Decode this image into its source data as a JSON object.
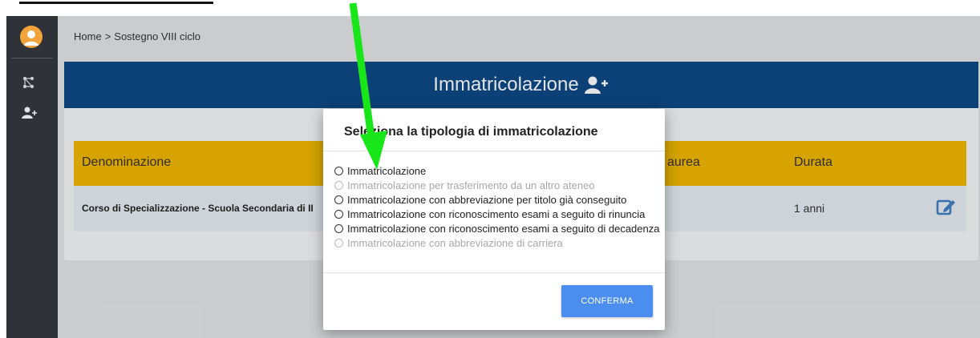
{
  "breadcrumb": {
    "home": "Home",
    "separator": ">",
    "current": "Sostegno VIII ciclo"
  },
  "banner": {
    "title": "Immatricolazione",
    "icon": "user-plus-icon"
  },
  "table": {
    "headers": [
      "Denominazione",
      "aurea",
      "Durata"
    ],
    "rows": [
      {
        "name": "Corso di Specializzazione - Scuola Secondaria di II G",
        "duration": "1 anni"
      }
    ]
  },
  "modal": {
    "title": "Seleziona la tipologia di immatricolazione",
    "options": [
      {
        "label": "Immatricolazione",
        "disabled": false
      },
      {
        "label": "Immatricolazione per trasferimento da un altro ateneo",
        "disabled": true
      },
      {
        "label": "Immatricolazione con abbreviazione per titolo già conseguito",
        "disabled": false
      },
      {
        "label": "Immatricolazione con riconoscimento esami a seguito di rinuncia",
        "disabled": false
      },
      {
        "label": "Immatricolazione con riconoscimento esami a seguito di decadenza",
        "disabled": false
      },
      {
        "label": "Immatricolazione con abbreviazione di carriera",
        "disabled": true
      }
    ],
    "confirm_label": "CONFERMA"
  },
  "colors": {
    "sidebar": "#2f3338",
    "banner": "#0e4a86",
    "table_header": "#f1b800",
    "confirm": "#4c8ef0",
    "arrow": "#19e619"
  }
}
